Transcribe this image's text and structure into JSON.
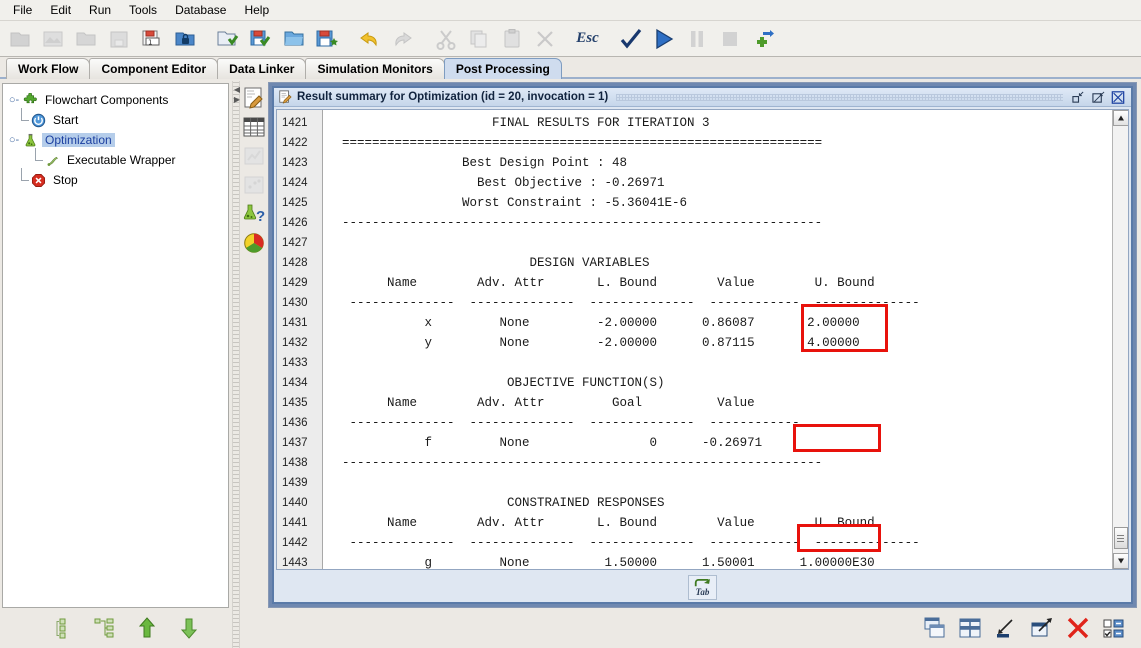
{
  "menubar": {
    "items": [
      {
        "label": "File"
      },
      {
        "label": "Edit"
      },
      {
        "label": "Run"
      },
      {
        "label": "Tools"
      },
      {
        "label": "Database"
      },
      {
        "label": "Help"
      }
    ]
  },
  "toolbar": {
    "buttons": [
      {
        "name": "new-project-icon",
        "label": "New Project",
        "enabled": false
      },
      {
        "name": "open-recent-icon",
        "label": "Open Recent",
        "enabled": false
      },
      {
        "name": "open-folder-icon",
        "label": "Open Folder",
        "enabled": false
      },
      {
        "name": "save-disabled-icon",
        "label": "Save",
        "enabled": false
      },
      {
        "name": "save-as-icon",
        "label": "Save As",
        "enabled": true
      },
      {
        "name": "lock-folder-icon",
        "label": "Lock Folder",
        "enabled": true
      },
      {
        "name": "open-check-icon",
        "label": "Open Verified",
        "enabled": true
      },
      {
        "name": "save-check-icon",
        "label": "Save Verified",
        "enabled": true
      },
      {
        "name": "folder-blue-icon",
        "label": "Open Library",
        "enabled": true
      },
      {
        "name": "save-new-icon",
        "label": "Save New",
        "enabled": true
      },
      {
        "name": "undo-icon",
        "label": "Undo",
        "enabled": true
      },
      {
        "name": "redo-icon",
        "label": "Redo",
        "enabled": false
      },
      {
        "name": "cut-icon",
        "label": "Cut",
        "enabled": false
      },
      {
        "name": "copy-icon",
        "label": "Copy",
        "enabled": false
      },
      {
        "name": "paste-icon",
        "label": "Paste",
        "enabled": false
      },
      {
        "name": "delete-x-icon",
        "label": "Delete",
        "enabled": false
      },
      {
        "name": "esc-icon",
        "label": "Esc",
        "enabled": true
      },
      {
        "name": "check-icon",
        "label": "Validate",
        "enabled": true
      },
      {
        "name": "run-icon",
        "label": "Run",
        "enabled": true
      },
      {
        "name": "pause-icon",
        "label": "Pause",
        "enabled": false
      },
      {
        "name": "stop-icon",
        "label": "Stop",
        "enabled": false
      },
      {
        "name": "plugin-export-icon",
        "label": "Export Plugin",
        "enabled": true
      }
    ],
    "esc_label": "Esc"
  },
  "tabs": [
    {
      "label": "Work Flow",
      "active": false
    },
    {
      "label": "Component Editor",
      "active": false
    },
    {
      "label": "Data Linker",
      "active": false
    },
    {
      "label": "Simulation Monitors",
      "active": false
    },
    {
      "label": "Post Processing",
      "active": true
    }
  ],
  "tree": {
    "root": {
      "label": "Flowchart Components",
      "icon": "puzzle-green-icon"
    },
    "children": [
      {
        "label": "Start",
        "icon": "power-blue-icon",
        "selected": false
      },
      {
        "label": "Optimization",
        "icon": "flask-green-icon",
        "selected": true
      },
      {
        "label": "Executable Wrapper",
        "icon": "wrapper-icon",
        "selected": false,
        "child": true
      },
      {
        "label": "Stop",
        "icon": "stop-red-icon",
        "selected": false
      }
    ]
  },
  "side_tools": [
    {
      "name": "report-edit-icon",
      "label": "Edit Report",
      "enabled": true
    },
    {
      "name": "table-grid-icon",
      "label": "Data Table",
      "enabled": true
    },
    {
      "name": "chart-disabled-icon",
      "label": "Chart",
      "enabled": false
    },
    {
      "name": "scatter-disabled-icon",
      "label": "Scatter Plot",
      "enabled": false
    },
    {
      "name": "flask-help-icon",
      "label": "Optimization Help",
      "enabled": true
    },
    {
      "name": "pie-chart-icon",
      "label": "Pie Chart",
      "enabled": true
    }
  ],
  "window": {
    "title": "Result summary for Optimization (id = 20, invocation = 1)",
    "icon": "document-edit-icon",
    "buttons": [
      {
        "name": "minimize-button",
        "label": "Minimize"
      },
      {
        "name": "maximize-button",
        "label": "Maximize"
      },
      {
        "name": "close-button",
        "label": "Close"
      }
    ]
  },
  "editor": {
    "first_line_number": 1421,
    "line_numbers": [
      1421,
      1422,
      1423,
      1424,
      1425,
      1426,
      1427,
      1428,
      1429,
      1430,
      1431,
      1432,
      1433,
      1434,
      1435,
      1436,
      1437,
      1438,
      1439,
      1440,
      1441,
      1442,
      1443
    ],
    "lines": [
      "                      FINAL RESULTS FOR ITERATION 3",
      "  ================================================================",
      "                  Best Design Point : 48",
      "                    Best Objective : -0.26971",
      "                  Worst Constraint : -5.36041E-6",
      "  ----------------------------------------------------------------",
      "",
      "                           DESIGN VARIABLES",
      "        Name        Adv. Attr       L. Bound        Value        U. Bound",
      "   --------------  --------------  --------------  ------------  --------------",
      "             x         None         -2.00000      0.86087       2.00000",
      "             y         None         -2.00000      0.87115       4.00000",
      "",
      "                        OBJECTIVE FUNCTION(S)",
      "        Name        Adv. Attr         Goal          Value",
      "   --------------  --------------  --------------  ------------",
      "             f         None                0      -0.26971",
      "  ----------------------------------------------------------------",
      "",
      "                        CONSTRAINED RESPONSES",
      "        Name        Adv. Attr       L. Bound        Value        U. Bound",
      "   --------------  --------------  --------------  ------------  --------------",
      "             g         None          1.50000      1.50001      1.00000E30",
      "",
      ">   <>   <>   <>   <>   <>   <>   <>   <>   <>   <>   <>   <>   <>   <>   <"
    ],
    "results": {
      "heading": "FINAL RESULTS FOR ITERATION 3",
      "iteration": 3,
      "best_design_point": 48,
      "best_objective": "-0.26971",
      "worst_constraint": "-5.36041E-6",
      "design_variables": {
        "section_title": "DESIGN VARIABLES",
        "headers": [
          "Name",
          "Adv. Attr",
          "L. Bound",
          "Value",
          "U. Bound"
        ],
        "rows": [
          {
            "name": "x",
            "adv_attr": "None",
            "l_bound": "-2.00000",
            "value": "0.86087",
            "u_bound": "2.00000",
            "highlight": true
          },
          {
            "name": "y",
            "adv_attr": "None",
            "l_bound": "-2.00000",
            "value": "0.87115",
            "u_bound": "4.00000",
            "highlight": true
          }
        ]
      },
      "objective_functions": {
        "section_title": "OBJECTIVE FUNCTION(S)",
        "headers": [
          "Name",
          "Adv. Attr",
          "Goal",
          "Value"
        ],
        "rows": [
          {
            "name": "f",
            "adv_attr": "None",
            "goal": "0",
            "value": "-0.26971",
            "highlight": true
          }
        ]
      },
      "constrained_responses": {
        "section_title": "CONSTRAINED RESPONSES",
        "headers": [
          "Name",
          "Adv. Attr",
          "L. Bound",
          "Value",
          "U. Bound"
        ],
        "rows": [
          {
            "name": "g",
            "adv_attr": "None",
            "l_bound": "1.50000",
            "value": "1.50001",
            "u_bound": "1.00000E30",
            "highlight": true
          }
        ]
      }
    },
    "highlight_color": "#e8120c"
  },
  "tab_footer": {
    "label": "Tab",
    "name": "tab-toggle-button"
  },
  "bottom_left_tools": [
    {
      "name": "list-nodes-icon",
      "label": "List View"
    },
    {
      "name": "tree-nodes-icon",
      "label": "Tree View"
    },
    {
      "name": "move-up-icon",
      "label": "Move Up"
    },
    {
      "name": "move-down-icon",
      "label": "Move Down"
    }
  ],
  "bottom_right_tools": [
    {
      "name": "cascade-windows-icon",
      "label": "Cascade Windows"
    },
    {
      "name": "tile-windows-icon",
      "label": "Tile Windows"
    },
    {
      "name": "minimize-all-icon",
      "label": "Minimize All"
    },
    {
      "name": "restore-all-icon",
      "label": "Restore All"
    },
    {
      "name": "close-all-icon",
      "label": "Close All"
    },
    {
      "name": "select-windows-icon",
      "label": "Select Windows"
    }
  ],
  "colors": {
    "accent": "#5a7aa8",
    "desktop": "#6f88b0",
    "selection": "#b5cdea",
    "highlight": "#e8120c",
    "chrome": "#ece9e4"
  }
}
